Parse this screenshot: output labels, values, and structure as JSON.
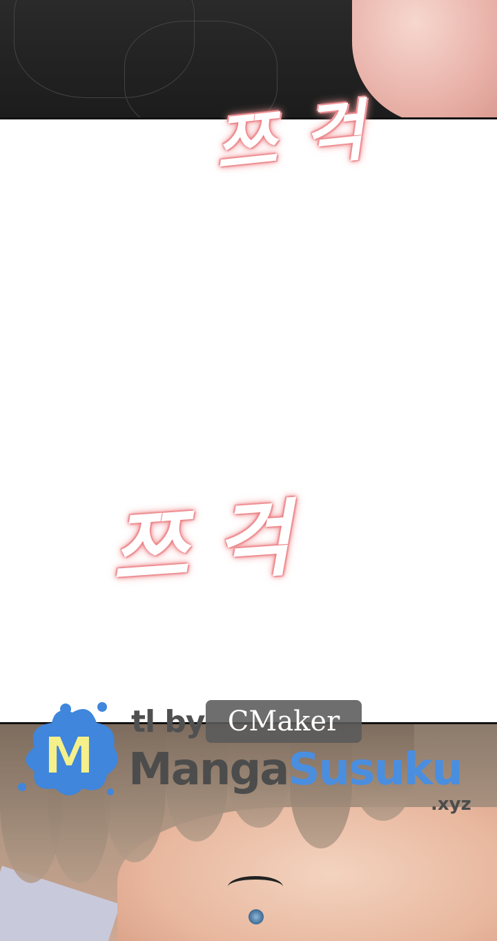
{
  "sfx": {
    "top_text": "쯔걱",
    "middle_text": "쯔걱"
  },
  "watermark": {
    "logo_letter": "M",
    "tl_by": "tl by",
    "translator": "CMaker",
    "brand_part1": "Manga",
    "brand_part2": "Susuku",
    "domain": ".xyz",
    "colors": {
      "brand_blue": "#4a8ee0",
      "brand_gray": "#4c4c4c",
      "logo_yellow": "#f5f08a"
    }
  }
}
